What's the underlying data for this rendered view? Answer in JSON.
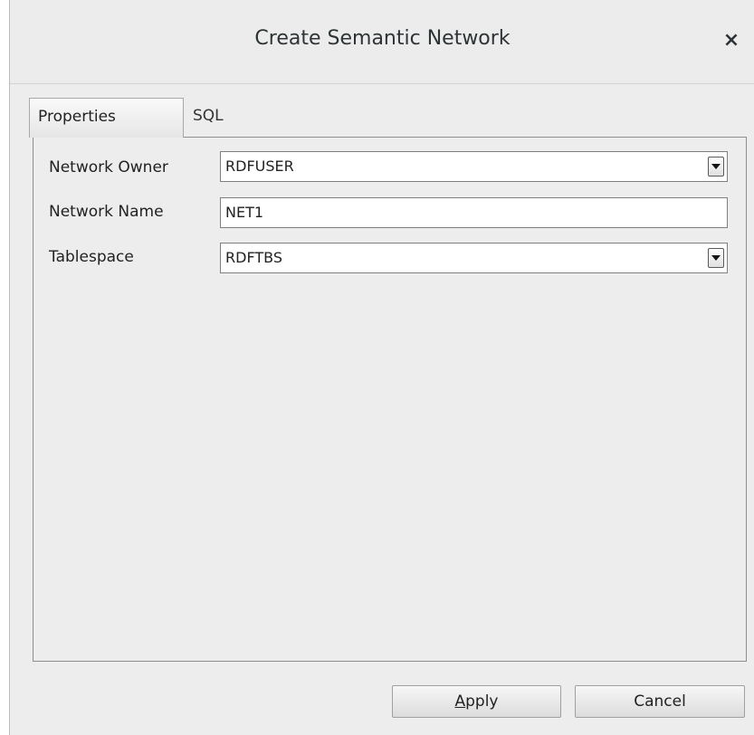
{
  "dialog": {
    "title": "Create Semantic Network",
    "close_glyph": "×"
  },
  "tabs": [
    {
      "label": "Properties",
      "active": true
    },
    {
      "label": "SQL",
      "active": false
    }
  ],
  "form": {
    "network_owner": {
      "label": "Network Owner",
      "value": "RDFUSER",
      "type": "combo"
    },
    "network_name": {
      "label": "Network Name",
      "value": "NET1",
      "type": "text"
    },
    "tablespace": {
      "label": "Tablespace",
      "value": "RDFTBS",
      "type": "combo"
    }
  },
  "buttons": {
    "apply": {
      "mnemonic": "A",
      "rest": "pply"
    },
    "cancel": {
      "label": "Cancel"
    }
  }
}
